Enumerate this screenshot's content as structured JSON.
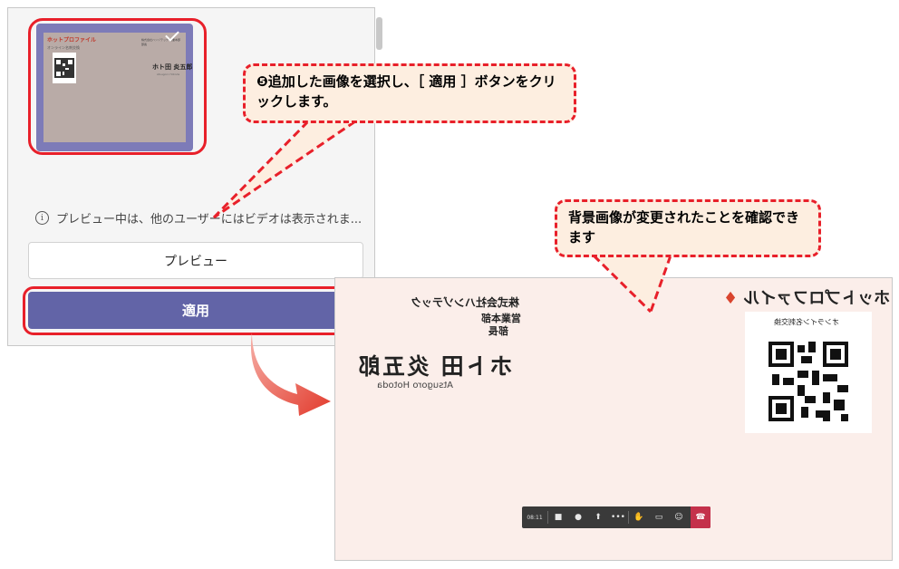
{
  "panel": {
    "thumbnail": {
      "logo_text": "ホットプロファイル",
      "tagline": "オンライン名刺交換",
      "company_lines": "株式会社ハンゾテック 営業本部 部長",
      "person_name": "ホト田 炎五郎",
      "person_romaji": "Atsugoro Hotoda"
    },
    "info_text": "プレビュー中は、他のユーザーにはビデオは表示されま...",
    "preview_button": "プレビュー",
    "apply_button": "適用"
  },
  "callouts": {
    "step5": "❺追加した画像を選択し、［ 適用 ］ボタンをクリックします。",
    "result": "背景画像が変更されたことを確認できます"
  },
  "video": {
    "company": "株式会社ハンゾテック",
    "department": "営業本部",
    "role": "部長",
    "name": "ホト田 炎五郎",
    "romaji": "Atsugoro Hotoda",
    "logo": "ホットプロファイル",
    "qr_label": "オンライン名刺交換",
    "toolbar": {
      "time": "08:11",
      "icons": [
        "camera-icon",
        "mic-icon",
        "share-icon",
        "more-icon",
        "raise-hand-icon",
        "chat-icon",
        "participants-icon",
        "hang-up-icon"
      ]
    }
  },
  "colors": {
    "accent": "#6264a7",
    "highlight": "#e8202a",
    "callout_fill": "#fdeee0",
    "video_bg": "#fbeeea",
    "hangup": "#c4314b"
  }
}
